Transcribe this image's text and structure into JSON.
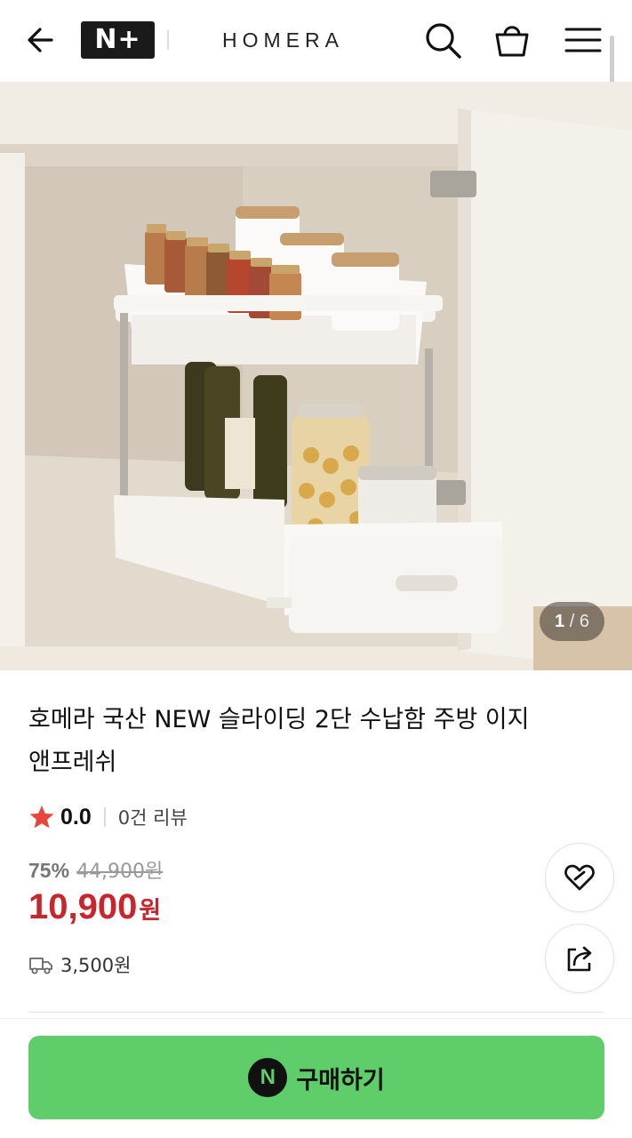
{
  "header": {
    "badge": "N+",
    "brand": "HOMERA"
  },
  "icons": {
    "back": "arrow-left-icon",
    "search": "search-icon",
    "cart": "shopping-bag-icon",
    "menu": "hamburger-menu-icon"
  },
  "gallery": {
    "current": "1",
    "separator": "/",
    "total": "6"
  },
  "product": {
    "title": "호메라 국산 NEW 슬라이딩 2단 수납함 주방 이지앤프레쉬",
    "rating": "0.0",
    "reviews": "0건 리뷰",
    "discount": "75%",
    "original_price": "44,900원",
    "price": "10,900",
    "price_unit": "원",
    "shipping": "3,500원"
  },
  "actions": {
    "buy_label": "구매하기",
    "buy_logo": "N"
  },
  "colors": {
    "price": "#c8252c",
    "buy_button": "#5fce6a",
    "star": "#e8453c"
  }
}
